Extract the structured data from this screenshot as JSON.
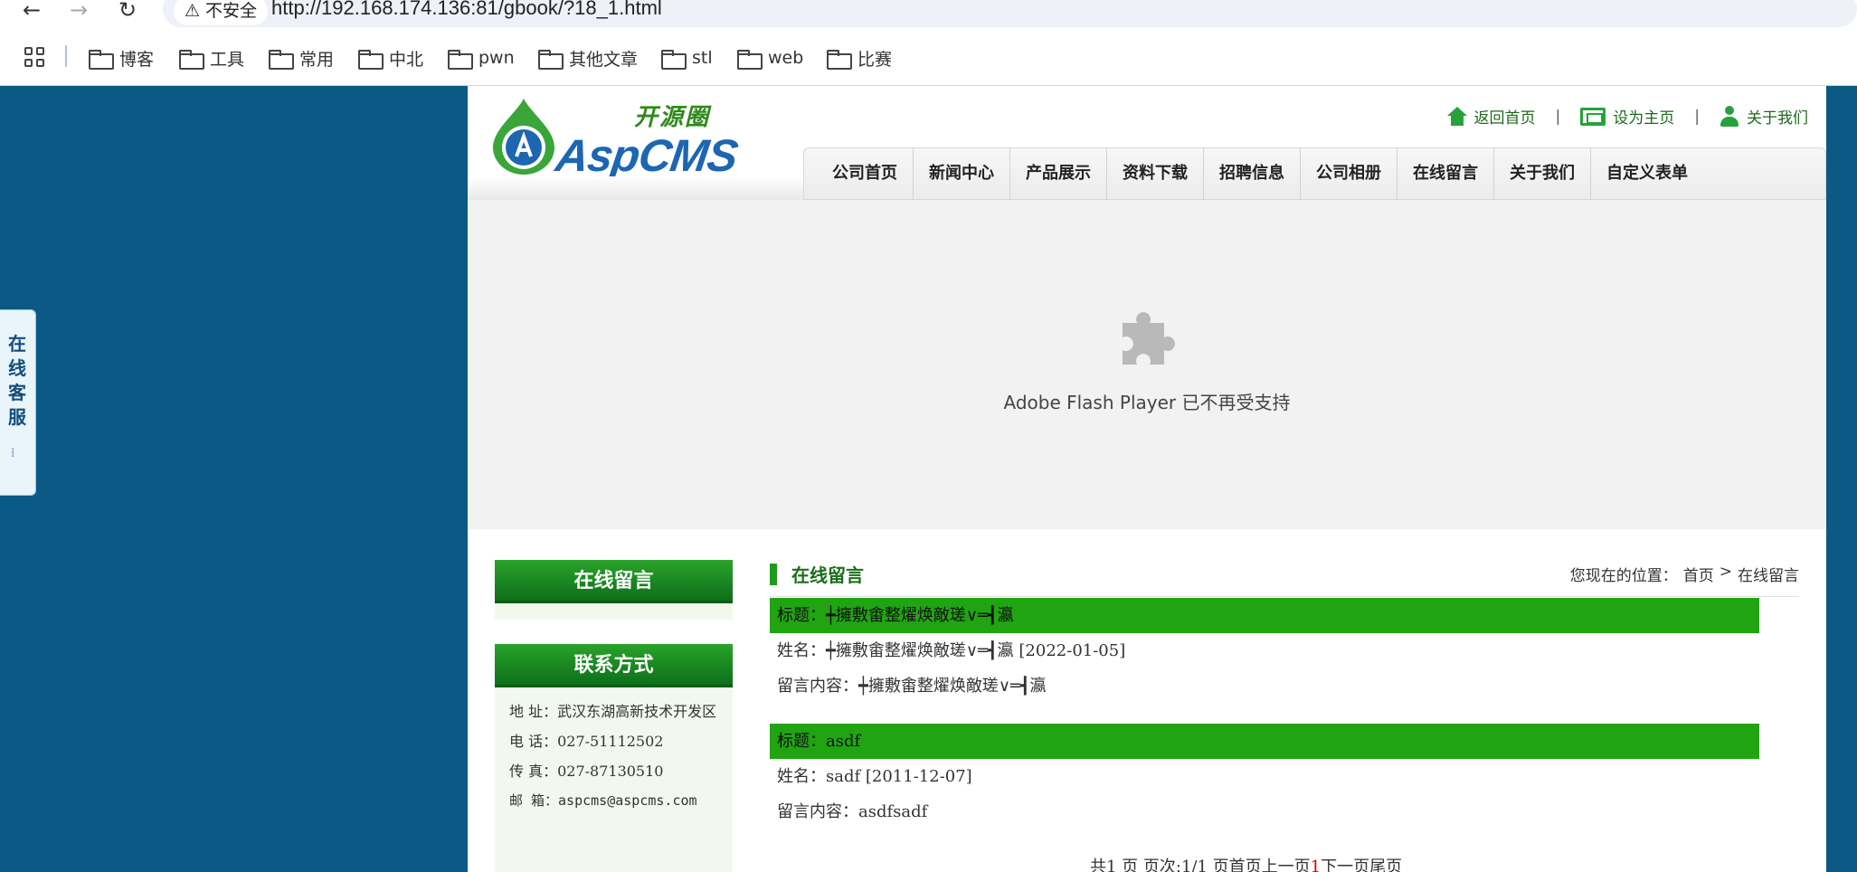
{
  "browser": {
    "insecure_label": "不安全",
    "url": "http://192.168.174.136:81/gbook/?18_1.html",
    "bookmarks": [
      "博客",
      "工具",
      "常用",
      "中北",
      "pwn",
      "其他文章",
      "stl",
      "web",
      "比赛"
    ]
  },
  "side_tab": {
    "label": "在线客服",
    "grip": "⁞"
  },
  "header": {
    "logo_cn": "开源圈",
    "logo_en": "AspCMS",
    "top_links": [
      "返回首页",
      "设为主页",
      "关于我们"
    ],
    "top_sep": "|",
    "nav": [
      "公司首页",
      "新闻中心",
      "产品展示",
      "资料下载",
      "招聘信息",
      "公司相册",
      "在线留言",
      "关于我们",
      "自定义表单"
    ]
  },
  "flash": {
    "message": "Adobe Flash Player 已不再受支持"
  },
  "sidebar": {
    "guestbook_title": "在线留言",
    "contact_title": "联系方式",
    "contact": [
      "地 址：武汉东湖高新技术开发区",
      "电 话：027-51112502",
      "传 真：027-87130510",
      "邮 箱：aspcms@aspcms.com"
    ]
  },
  "content": {
    "title": "在线留言",
    "breadcrumb": {
      "prefix": "您现在的位置：",
      "home": "首页",
      "sep": ">",
      "current": "在线留言"
    },
    "messages": [
      {
        "title": "标题：┿擁敷畬整燿焕敵瑳∨═┫瀛",
        "name": "姓名：┿擁敷畬整燿焕敵瑳∨═┫瀛 [2022-01-05]",
        "body": "留言内容：┿擁敷畬整燿焕敵瑳∨═┫瀛"
      },
      {
        "title": "标题：asdf",
        "name": "姓名：sadf [2011-12-07]",
        "body": "留言内容：asdfsadf"
      }
    ],
    "pager": {
      "text_before": "共1 页 页次:1/1 页首页上一页",
      "current": "1",
      "text_after": "下一页尾页"
    }
  },
  "colors": {
    "page_bg": "#0a5a85",
    "accent_green": "#21a412",
    "link_green": "#1b6a1b"
  }
}
